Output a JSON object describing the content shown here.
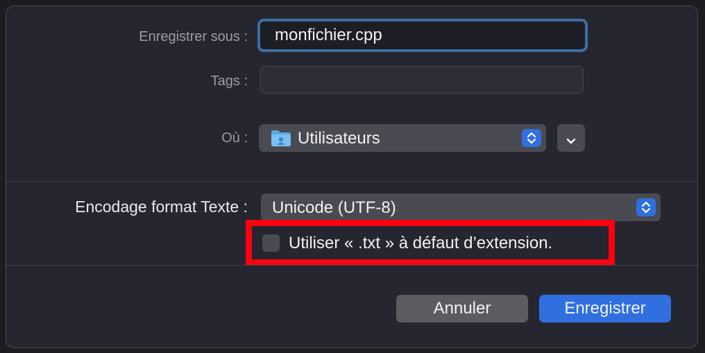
{
  "save_as": {
    "label": "Enregistrer sous :",
    "value": "monfichier.cpp"
  },
  "tags": {
    "label": "Tags :",
    "value": ""
  },
  "location": {
    "label": "Où :",
    "value": "Utilisateurs",
    "icon": "folder-icon"
  },
  "encoding": {
    "label": "Encodage format Texte :",
    "value": "Unicode (UTF-8)"
  },
  "extension_option": {
    "label": "Utiliser « .txt » à défaut d’extension.",
    "checked": false
  },
  "buttons": {
    "cancel": "Annuler",
    "save": "Enregistrer"
  },
  "colors": {
    "accent": "#2f6fe0",
    "highlight": "#ff0010",
    "background": "#262630"
  }
}
